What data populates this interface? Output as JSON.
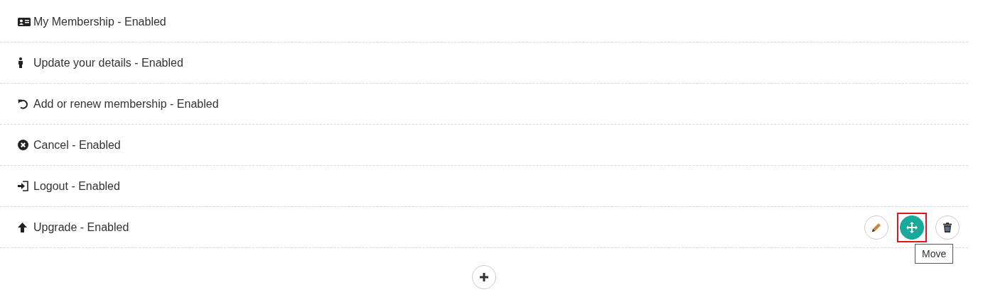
{
  "items": [
    {
      "label": "My Membership - Enabled",
      "kind": "card"
    },
    {
      "label": "Update your details - Enabled",
      "kind": "person"
    },
    {
      "label": "Add or renew membership - Enabled",
      "kind": "undo"
    },
    {
      "label": "Cancel - Enabled",
      "kind": "cancel"
    },
    {
      "label": "Logout - Enabled",
      "kind": "login"
    },
    {
      "label": "Upgrade - Enabled",
      "kind": "up",
      "actions": [
        {
          "kind": "edit",
          "highlighted": false
        },
        {
          "kind": "move",
          "highlighted": true
        },
        {
          "kind": "delete",
          "highlighted": false
        }
      ],
      "tooltip": "Move"
    }
  ]
}
